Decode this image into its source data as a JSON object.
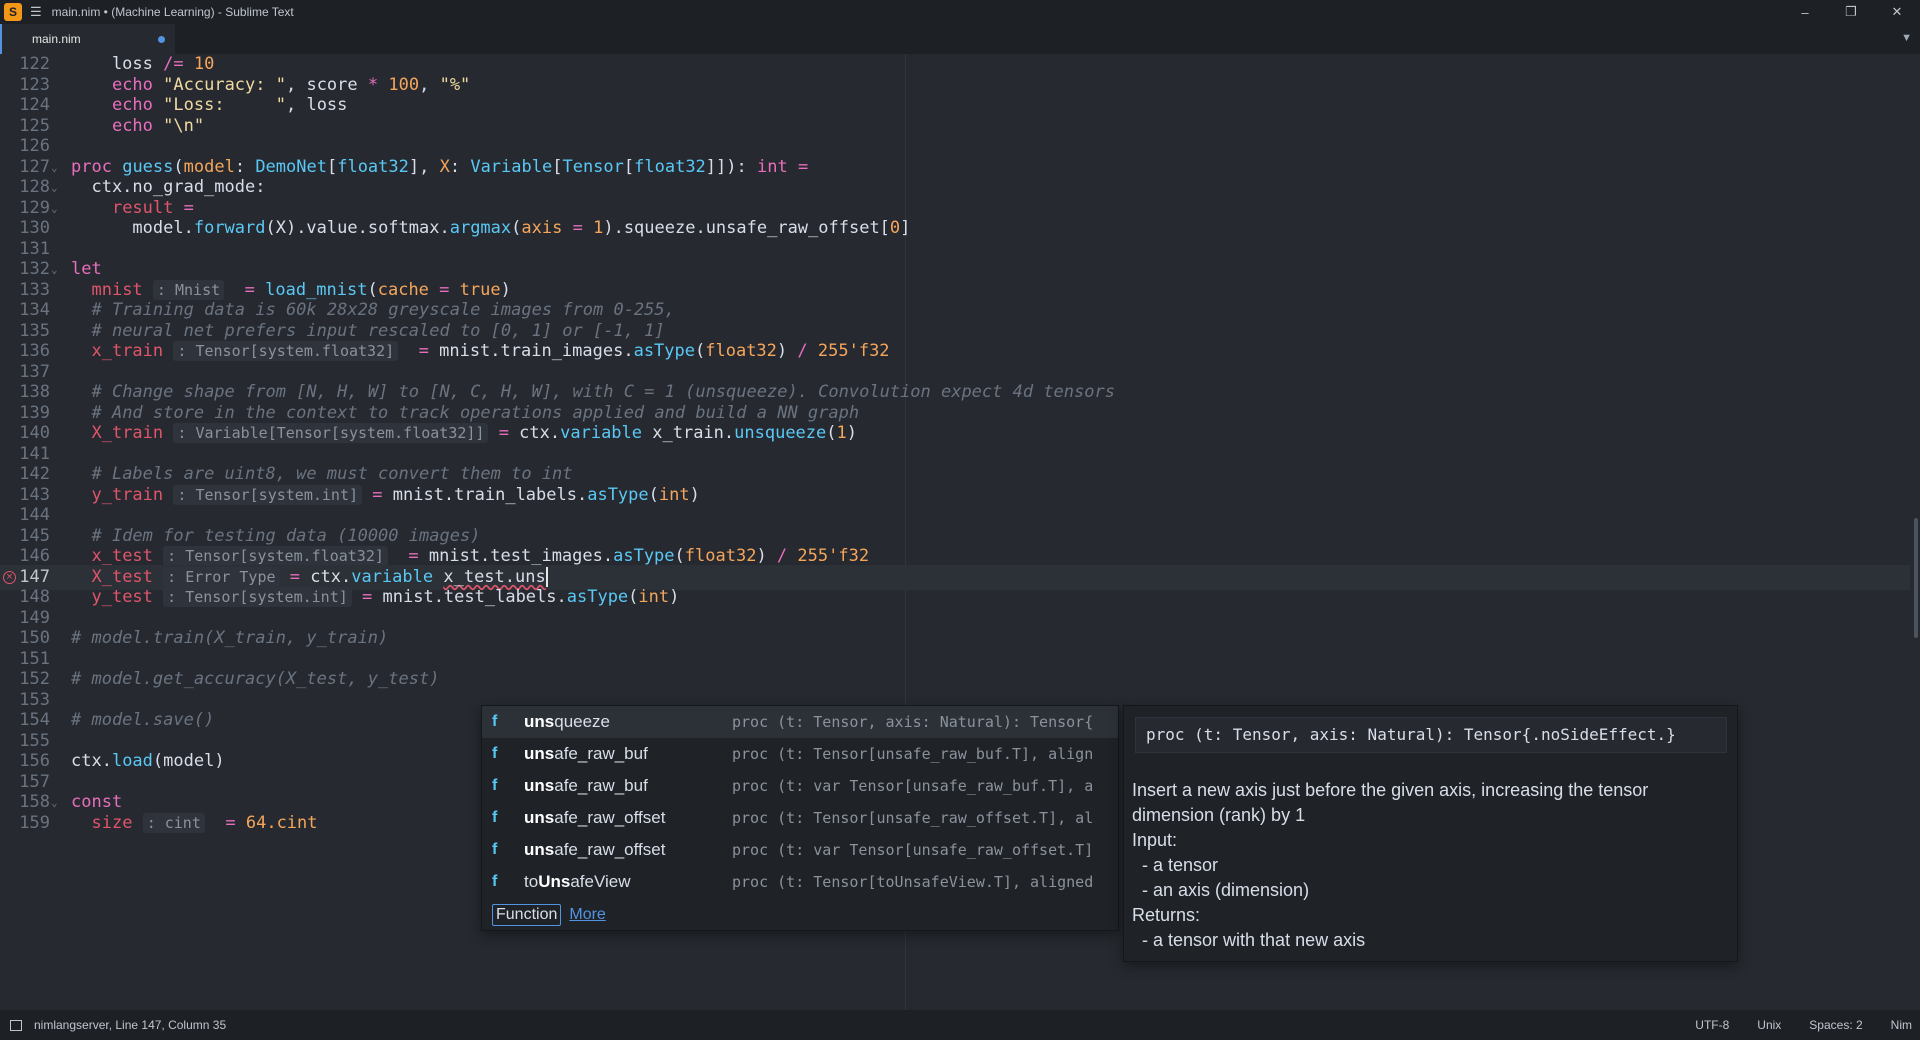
{
  "window": {
    "title": "main.nim • (Machine Learning) - Sublime Text",
    "app_icon": "S",
    "menu_icon": "☰",
    "minimize": "–",
    "restore": "❐",
    "close": "✕"
  },
  "tabs": [
    {
      "label": "main.nim",
      "dirty": true
    }
  ],
  "tab_dropdown": "▼",
  "editor": {
    "active_line": 147,
    "lines": [
      {
        "n": "122",
        "html": "    loss <span class=\"op\">/=</span> <span class=\"num\">10</span>"
      },
      {
        "n": "123",
        "html": "    <span class=\"kw\">echo</span> <span class=\"str\">\"Accuracy: \"</span>, score <span class=\"op\">*</span> <span class=\"num\">100</span>, <span class=\"str\">\"%\"</span>"
      },
      {
        "n": "124",
        "html": "    <span class=\"kw\">echo</span> <span class=\"str\">\"Loss:     \"</span>, loss"
      },
      {
        "n": "125",
        "html": "    <span class=\"kw\">echo</span> <span class=\"str\">\"\\n\"</span>"
      },
      {
        "n": "126",
        "html": ""
      },
      {
        "n": "127",
        "fold": "⌄",
        "html": "<span class=\"kw\">proc</span> <span class=\"fn\">guess</span>(<span class=\"typ2\">model</span>: <span class=\"type\">DemoNet</span>[<span class=\"type\">float32</span>], <span class=\"typ2\">X</span>: <span class=\"type\">Variable</span>[<span class=\"type\">Tensor</span>[<span class=\"type\">float32</span>]]): <span class=\"kw\">int</span> <span class=\"op\">=</span>"
      },
      {
        "n": "128",
        "fold": "⌄",
        "html": "  ctx.no_grad_mode:"
      },
      {
        "n": "129",
        "fold": "⌄",
        "html": "    <span class=\"var\">result</span> <span class=\"op\">=</span>"
      },
      {
        "n": "130",
        "html": "      model.<span class=\"fn\">forward</span>(X).value.softmax.<span class=\"fn\">argmax</span>(<span class=\"typ2\">axis</span> <span class=\"op\">=</span> <span class=\"num\">1</span>).squeeze.unsafe_raw_offset[<span class=\"num\">0</span>]"
      },
      {
        "n": "131",
        "html": ""
      },
      {
        "n": "132",
        "fold": "⌄",
        "html": "<span class=\"kw\">let</span>"
      },
      {
        "n": "133",
        "html": "  <span class=\"var\">mnist</span> <span class=\"hint\">: Mnist</span>  <span class=\"op\">=</span> <span class=\"fn\">load_mnist</span>(<span class=\"typ2\">cache</span> <span class=\"op\">=</span> <span class=\"num\">true</span>)"
      },
      {
        "n": "134",
        "html": "  <span class=\"cm\"># Training data is 60k 28x28 greyscale images from 0-255,</span>"
      },
      {
        "n": "135",
        "html": "  <span class=\"cm\"># neural net prefers input rescaled to [0, 1] or [-1, 1]</span>"
      },
      {
        "n": "136",
        "html": "  <span class=\"var\">x_train</span> <span class=\"hint\">: Tensor[system.float32]</span>  <span class=\"op\">=</span> mnist.train_images.<span class=\"fn\">asType</span>(<span class=\"typ2\">float32</span>) <span class=\"op\">/</span> <span class=\"num\">255'f32</span>"
      },
      {
        "n": "137",
        "html": ""
      },
      {
        "n": "138",
        "html": "  <span class=\"cm\"># Change shape from [N, H, W] to [N, C, H, W], with C = 1 (unsqueeze). Convolution expect 4d tensors</span>"
      },
      {
        "n": "139",
        "html": "  <span class=\"cm\"># And store in the context to track operations applied and build a NN graph</span>"
      },
      {
        "n": "140",
        "html": "  <span class=\"var\">X_train</span> <span class=\"hint\">: Variable[Tensor[system.float32]]</span> <span class=\"op\">=</span> ctx.<span class=\"fn\">variable</span> x_train.<span class=\"fn\">unsqueeze</span>(<span class=\"num\">1</span>)"
      },
      {
        "n": "141",
        "html": ""
      },
      {
        "n": "142",
        "html": "  <span class=\"cm\"># Labels are uint8, we must convert them to int</span>"
      },
      {
        "n": "143",
        "html": "  <span class=\"var\">y_train</span> <span class=\"hint\">: Tensor[system.int]</span> <span class=\"op\">=</span> mnist.train_labels.<span class=\"fn\">asType</span>(<span class=\"typ2\">int</span>)"
      },
      {
        "n": "144",
        "html": ""
      },
      {
        "n": "145",
        "html": "  <span class=\"cm\"># Idem for testing data (10000 images)</span>"
      },
      {
        "n": "146",
        "html": "  <span class=\"var\">x_test</span> <span class=\"hint\">: Tensor[system.float32]</span>  <span class=\"op\">=</span> mnist.test_images.<span class=\"fn\">asType</span>(<span class=\"typ2\">float32</span>) <span class=\"op\">/</span> <span class=\"num\">255'f32</span>"
      },
      {
        "n": "147",
        "error": true,
        "html": "  <span class=\"var\">X_test</span> <span class=\"hint\">: Error Type</span> <span class=\"op\">=</span> ctx.<span class=\"fn\">variable</span> <span class=\"err-under\">x_test.uns</span><span class=\"caret\"></span>"
      },
      {
        "n": "148",
        "html": "  <span class=\"var\">y_test</span> <span class=\"hint\">: Tensor[system.int]</span> <span class=\"op\">=</span> mnist.test_labels.<span class=\"fn\">asType</span>(<span class=\"typ2\">int</span>)"
      },
      {
        "n": "149",
        "html": ""
      },
      {
        "n": "150",
        "html": "<span class=\"cm\"># model.train(X_train, y_train)</span>"
      },
      {
        "n": "151",
        "html": ""
      },
      {
        "n": "152",
        "html": "<span class=\"cm\"># model.get_accuracy(X_test, y_test)</span>"
      },
      {
        "n": "153",
        "html": ""
      },
      {
        "n": "154",
        "html": "<span class=\"cm\"># model.save()</span>"
      },
      {
        "n": "155",
        "html": ""
      },
      {
        "n": "156",
        "html": "ctx.<span class=\"fn\">load</span>(model)"
      },
      {
        "n": "157",
        "html": ""
      },
      {
        "n": "158",
        "fold": "⌄",
        "html": "<span class=\"kw\">const</span>"
      },
      {
        "n": "159",
        "html": "  <span class=\"var\">size</span> <span class=\"hint\">: cint</span>  <span class=\"op\">=</span> <span class=\"num\">64.cint</span>"
      }
    ]
  },
  "autocomplete": {
    "items": [
      {
        "kind": "f",
        "match": "uns",
        "rest": "queeze",
        "prefix": "",
        "detail": "proc (t: Tensor, axis: Natural): Tensor{",
        "selected": true
      },
      {
        "kind": "f",
        "match": "uns",
        "rest": "afe_raw_buf",
        "prefix": "",
        "detail": "proc (t: Tensor[unsafe_raw_buf.T], align"
      },
      {
        "kind": "f",
        "match": "uns",
        "rest": "afe_raw_buf",
        "prefix": "",
        "detail": "proc (t: var Tensor[unsafe_raw_buf.T], a"
      },
      {
        "kind": "f",
        "match": "uns",
        "rest": "afe_raw_offset",
        "prefix": "",
        "detail": "proc (t: Tensor[unsafe_raw_offset.T], al"
      },
      {
        "kind": "f",
        "match": "uns",
        "rest": "afe_raw_offset",
        "prefix": "",
        "detail": "proc (t: var Tensor[unsafe_raw_offset.T]"
      },
      {
        "kind": "f",
        "match": "Uns",
        "rest": "afeView",
        "prefix": "to",
        "detail": "proc (t: Tensor[toUnsafeView.T], aligned"
      }
    ],
    "footer_kind": "Function",
    "footer_more": "More"
  },
  "doc": {
    "signature": "proc (t: Tensor, axis: Natural): Tensor{.noSideEffect.}",
    "lines": [
      "Insert a new axis just before the given axis, increasing the tensor",
      "dimension (rank) by 1",
      "Input:",
      "  - a tensor",
      "  - an axis (dimension)",
      "Returns:",
      "  - a tensor with that new axis"
    ]
  },
  "status": {
    "left": "nimlangserver, Line 147, Column 35",
    "encoding": "UTF-8",
    "line_endings": "Unix",
    "indent": "Spaces: 2",
    "syntax": "Nim"
  }
}
